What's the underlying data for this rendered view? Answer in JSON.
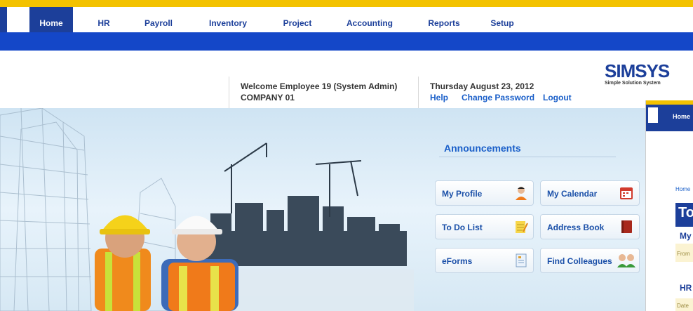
{
  "nav": {
    "items": [
      "Home",
      "HR",
      "Payroll",
      "Inventory",
      "Project",
      "Accounting",
      "Reports",
      "Setup"
    ],
    "active": "Home"
  },
  "header": {
    "welcome": "Welcome Employee 19 (System Admin)",
    "company": "COMPANY 01",
    "date": "Thursday August 23, 2012",
    "links": {
      "help": "Help",
      "change_password": "Change Password",
      "logout": "Logout"
    }
  },
  "logo": {
    "text": "SIMSYS",
    "subtitle": "Simple Solution System"
  },
  "announcements": {
    "title": "Announcements",
    "buttons": {
      "my_profile": "My Profile",
      "my_calendar": "My Calendar",
      "todo": "To Do List",
      "address_book": "Address Book",
      "eforms": "eForms",
      "find_colleagues": "Find Colleagues"
    }
  },
  "side_preview": {
    "nav_home": "Home",
    "breadcrumb": "Home",
    "title_fragment": "To",
    "my_fragment": "My",
    "from_fragment": "From",
    "hr_fragment": "HR",
    "date_fragment": "Date"
  },
  "colors": {
    "accent_blue": "#1c3f9a",
    "band_blue": "#1447c8",
    "yellow": "#f3c200",
    "link_blue": "#1a5fc9"
  }
}
